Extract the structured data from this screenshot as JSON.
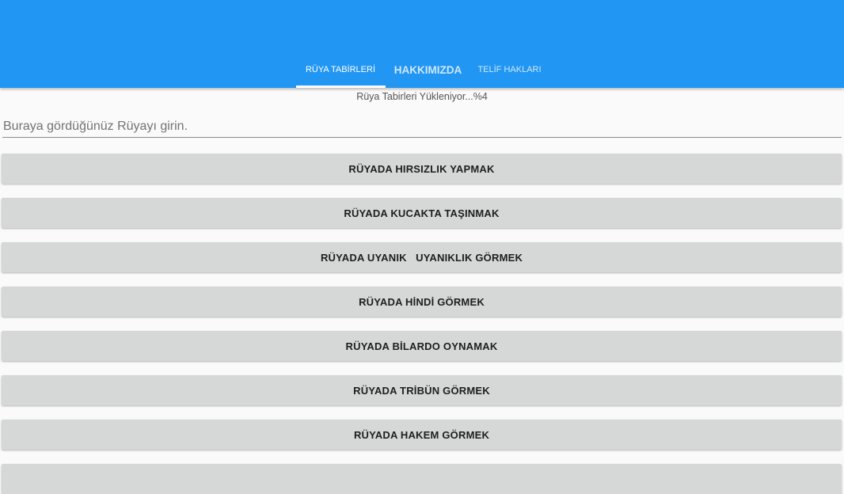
{
  "colors": {
    "appbar": "#2196f3",
    "button": "#d6d7d7",
    "background": "#fafafa"
  },
  "tabs": [
    {
      "label": "RÜYA TABİRLERİ",
      "active": true
    },
    {
      "label": "HAKKIMIZDA",
      "active": false
    },
    {
      "label": "TELİF HAKLARI",
      "active": false
    }
  ],
  "status": {
    "text": "Rüya Tabirleri Yükleniyor...%4",
    "progress_percent": 4
  },
  "search": {
    "placeholder": "Buraya gördüğünüz Rüyayı girin.",
    "value": ""
  },
  "dreams": [
    "RÜYADA HIRSIZLIK YAPMAK",
    "RÜYADA KUCAKTA TAŞINMAK",
    "RÜYADA UYANIK   UYANIKLIK GÖRMEK",
    "RÜYADA HİNDİ GÖRMEK",
    "RÜYADA BİLARDO OYNAMAK",
    "RÜYADA TRİBÜN GÖRMEK",
    "RÜYADA HAKEM GÖRMEK",
    ""
  ]
}
